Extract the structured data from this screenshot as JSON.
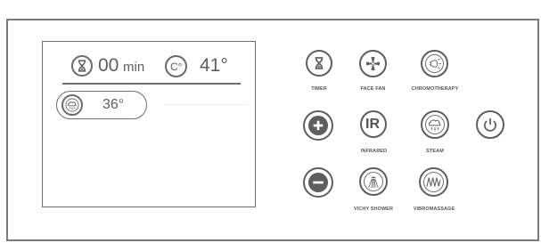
{
  "display": {
    "timer_value": "00",
    "timer_unit": "min",
    "temp_icon_text": "C°",
    "temperature": "41°",
    "steam_temperature": "36°"
  },
  "buttons": {
    "timer": "TIMER",
    "face_fan": "FACE FAN",
    "chromotherapy": "CHROMOTHERAPY",
    "plus": "",
    "infrared_icon": "IR",
    "infrared": "INFRARED",
    "steam": "STEAM",
    "power": "",
    "minus": "",
    "vichy_shower": "VICHY SHOWER",
    "vibromassage": "VIBROMASSAGE"
  },
  "icons": {
    "timer": "hourglass-icon",
    "face_fan": "fan-icon",
    "chromotherapy": "light-bulb-icon",
    "plus": "plus-icon",
    "infrared": "ir-icon",
    "steam": "steam-cloud-icon",
    "power": "power-icon",
    "minus": "minus-icon",
    "vichy_shower": "shower-icon",
    "vibromassage": "vibration-wave-icon"
  },
  "colors": {
    "stroke": "#5e5e5e",
    "border": "#7a7a7a",
    "background": "#ffffff"
  }
}
